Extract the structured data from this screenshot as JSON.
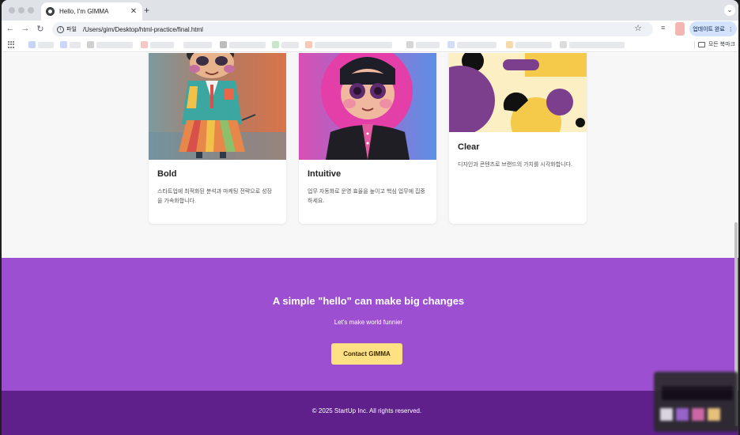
{
  "browser": {
    "tab_title": "Hello, I'm GIMMA",
    "tab_close": "✕",
    "new_tab": "+",
    "tab_search": "⌄",
    "nav_back": "←",
    "nav_forward": "→",
    "nav_reload": "↻",
    "scheme_label": "파일",
    "url": "/Users/gim/Desktop/html-practice/final.html",
    "bookmark_star": "☆",
    "reading_list": "≡",
    "update_label": "업데이트 완료",
    "update_menu": "⋮",
    "all_bookmarks_label": "모든 북마크"
  },
  "cards": [
    {
      "title": "Bold",
      "desc": "스타트업에 최적화된 분석과 마케팅 전략으로 성장을 가속화합니다."
    },
    {
      "title": "Intuitive",
      "desc": "업무 자동화로 운영 효율을 높이고 핵심 업무에 집중하세요."
    },
    {
      "title": "Clear",
      "desc": "디자인과 콘텐츠로 브랜드의 가치를 시각화합니다."
    }
  ],
  "cta": {
    "title": "A simple \"hello\" can make big changes",
    "subtitle": "Let's make world funnier",
    "button": "Contact GIMMA"
  },
  "footer": {
    "text": "© 2025 StartUp Inc. All rights reserved."
  },
  "colors": {
    "cta_bg": "#9d4fd1",
    "footer_bg": "#5f208c",
    "cta_button": "#ffe082"
  }
}
